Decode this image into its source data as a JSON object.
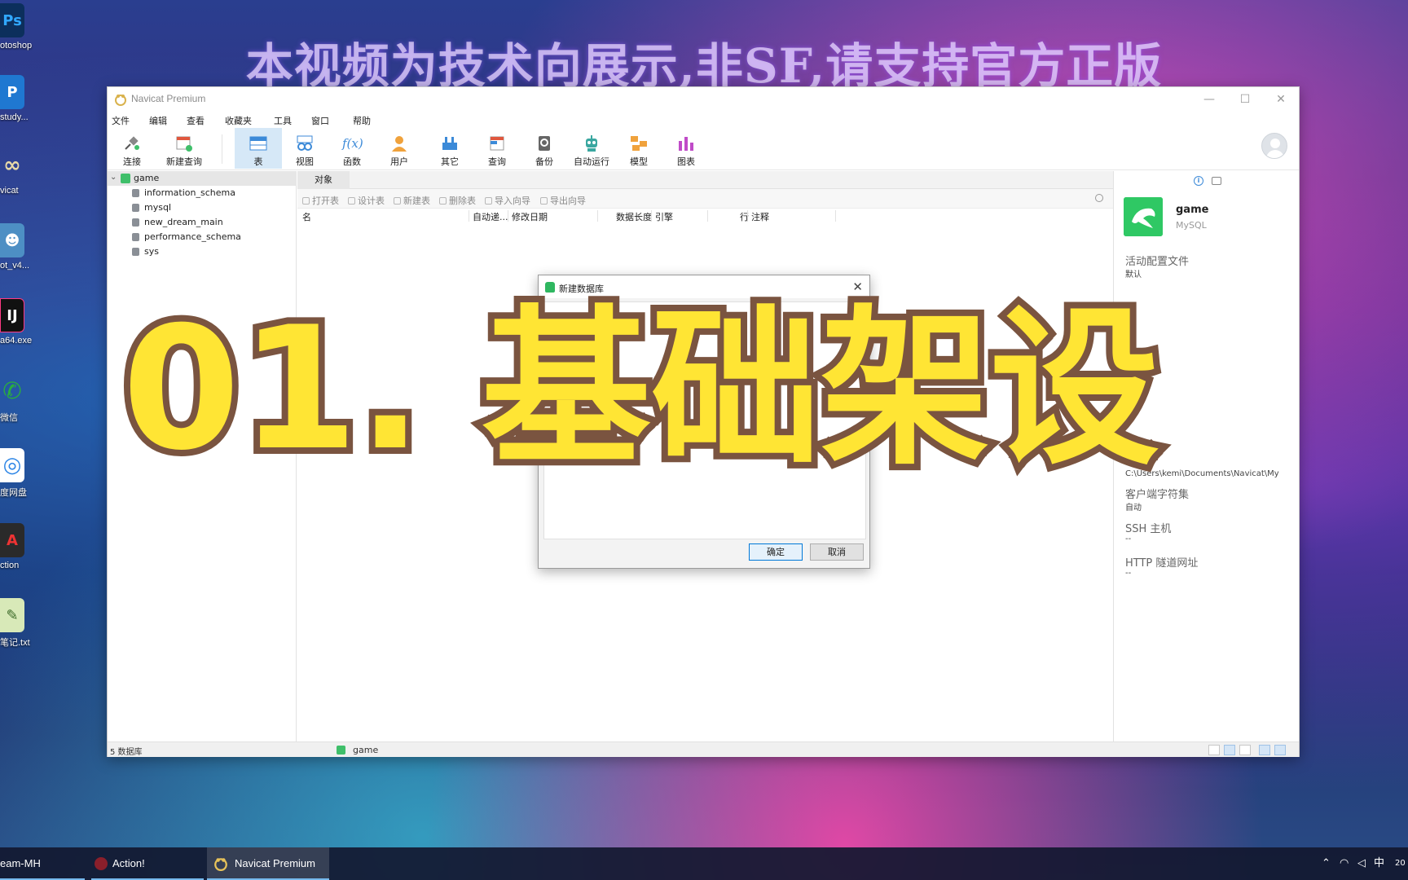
{
  "watermark": "本视频为技术向展示,非SF,请支持官方正版",
  "desktop": {
    "icons": [
      {
        "glyph": "Ps",
        "label": "otoshop",
        "color": "#0c2f5c"
      },
      {
        "glyph": "P",
        "label": "study...",
        "color": "#1f78d1"
      },
      {
        "glyph": "∞",
        "label": "vicat",
        "color": "#3a3a3a"
      },
      {
        "glyph": "☻",
        "label": "ot_v4...",
        "color": "#4d8fc4"
      },
      {
        "glyph": "IJ",
        "label": "a64.exe",
        "color": "#111111"
      },
      {
        "glyph": "✆",
        "label": "微信",
        "color": "#2aae3e"
      },
      {
        "glyph": "◎",
        "label": "度网盘",
        "color": "#2e86e6"
      },
      {
        "glyph": "A",
        "label": "ction",
        "color": "#2a2a2a"
      },
      {
        "glyph": "✎",
        "label": "笔记.txt",
        "color": "#5f9e4a"
      }
    ]
  },
  "window": {
    "title": "Navicat Premium",
    "menu": [
      "文件",
      "编辑",
      "查看",
      "收藏夹",
      "工具",
      "窗口",
      "帮助"
    ],
    "toolbar": [
      {
        "label": "连接",
        "icon": "connect-icon"
      },
      {
        "label": "新建查询",
        "icon": "new-query-icon"
      },
      {
        "label": "表",
        "icon": "table-icon"
      },
      {
        "label": "视图",
        "icon": "view-icon"
      },
      {
        "label": "函数",
        "icon": "function-icon"
      },
      {
        "label": "用户",
        "icon": "user-icon"
      },
      {
        "label": "其它",
        "icon": "other-icon"
      },
      {
        "label": "查询",
        "icon": "query-icon"
      },
      {
        "label": "备份",
        "icon": "backup-icon"
      },
      {
        "label": "自动运行",
        "icon": "robot-icon"
      },
      {
        "label": "模型",
        "icon": "model-icon"
      },
      {
        "label": "图表",
        "icon": "chart-icon"
      }
    ],
    "function_glyph": "f(x)"
  },
  "tree": {
    "connection": "game",
    "databases": [
      "information_schema",
      "mysql",
      "new_dream_main",
      "performance_schema",
      "sys"
    ]
  },
  "main": {
    "tab": "对象",
    "tools": [
      "打开表",
      "设计表",
      "新建表",
      "删除表",
      "导入向导",
      "导出向导"
    ],
    "columns": [
      "名",
      "自动递...",
      "修改日期",
      "数据长度",
      "引擎",
      "行",
      "注释"
    ]
  },
  "info": {
    "name": "game",
    "type": "MySQL",
    "fields": [
      {
        "key": "活动配置文件",
        "value": "默认"
      },
      {
        "key": "",
        "value": "C:\\Users\\kemi\\Documents\\Navicat\\My"
      },
      {
        "key": "客户端字符集",
        "value": "自动"
      },
      {
        "key": "SSH 主机",
        "value": "--"
      },
      {
        "key": "HTTP 隧道网址",
        "value": "--"
      }
    ]
  },
  "status": {
    "count": "5 数据库",
    "connection": "game"
  },
  "dialog": {
    "title": "新建数据库",
    "ok": "确定",
    "cancel": "取消"
  },
  "overlay_title": "01. 基础架设",
  "taskbar": {
    "items": [
      "eam-MH",
      "Action!",
      "Navicat Premium"
    ],
    "tray_ime": "中",
    "tray_clock": "20"
  },
  "colors": {
    "overlay_fill": "#ffe534",
    "overlay_stroke": "#7a5440",
    "accent": "#0078d7",
    "mysql_green": "#2fc864"
  }
}
